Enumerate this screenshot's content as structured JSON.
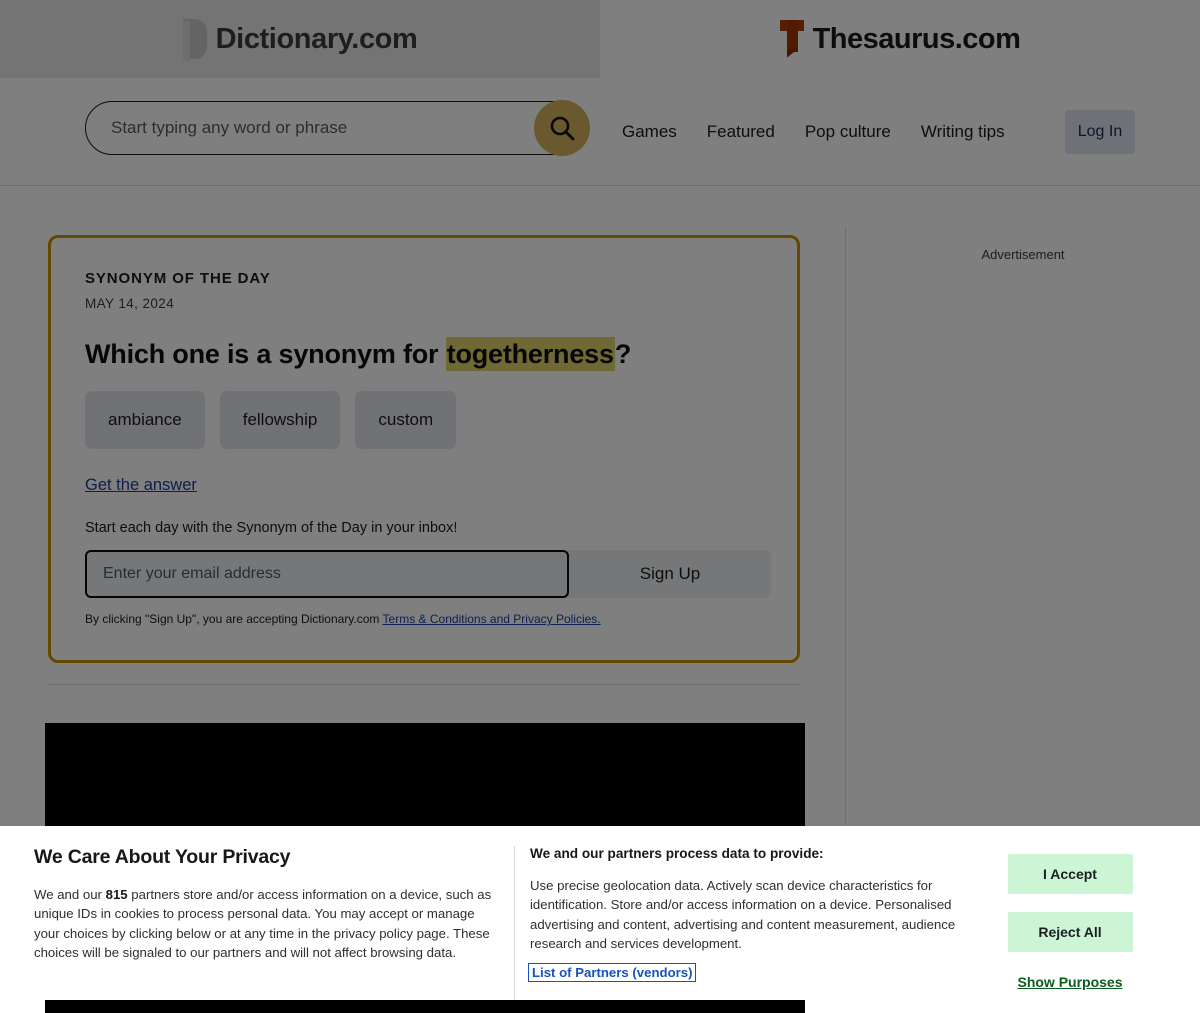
{
  "tabs": [
    {
      "name": "dictionary",
      "label": "Dictionary.com",
      "active": false
    },
    {
      "name": "thesaurus",
      "label": "Thesaurus.com",
      "active": true
    }
  ],
  "header": {
    "search": {
      "placeholder": "Start typing any word or phrase",
      "value": "",
      "button_icon": "search-icon",
      "button_color": "#d4b15f"
    },
    "nav": [
      {
        "label": "Games"
      },
      {
        "label": "Featured"
      },
      {
        "label": "Pop culture"
      },
      {
        "label": "Writing tips"
      }
    ],
    "login_label": "Log In"
  },
  "synonym_of_the_day": {
    "kicker": "SYNONYM OF THE DAY",
    "date": "MAY 14, 2024",
    "question_prefix": "Which one is a synonym for ",
    "question_word": "togetherness",
    "question_suffix": "?",
    "highlight_color": "#ddd36a",
    "border_color": "#c79200",
    "options": [
      {
        "label": "ambiance"
      },
      {
        "label": "fellowship"
      },
      {
        "label": "custom"
      }
    ],
    "answer_link": "Get the answer",
    "newsletter_copy": "Start each day with the Synonym of the Day in your inbox!",
    "email_placeholder": "Enter your email address",
    "email_value": "",
    "signup_label": "Sign Up",
    "legal_prefix": "By clicking \"Sign Up\", you are accepting Dictionary.com ",
    "legal_link": "Terms & Conditions and Privacy Policies."
  },
  "ad": {
    "label": "Advertisement"
  },
  "privacy_banner": {
    "title": "We Care About Your Privacy",
    "body_pre": "We and our ",
    "partner_count": "815",
    "body_post": " partners store and/or access information on a device, such as unique IDs in cookies to process personal data. You may accept or manage your choices by clicking below or at any time in the privacy policy page. These choices will be signaled to our partners and will not affect browsing data.",
    "purposes_title": "We and our partners process data to provide:",
    "purposes_body": "Use precise geolocation data. Actively scan device characteristics for identification. Store and/or access information on a device. Personalised advertising and content, advertising and content measurement, audience research and services development.",
    "vendors_link": "List of Partners (vendors)",
    "accept_label": "I Accept",
    "reject_label": "Reject All",
    "show_purposes_label": "Show Purposes",
    "button_color": "#ccf5d6"
  }
}
